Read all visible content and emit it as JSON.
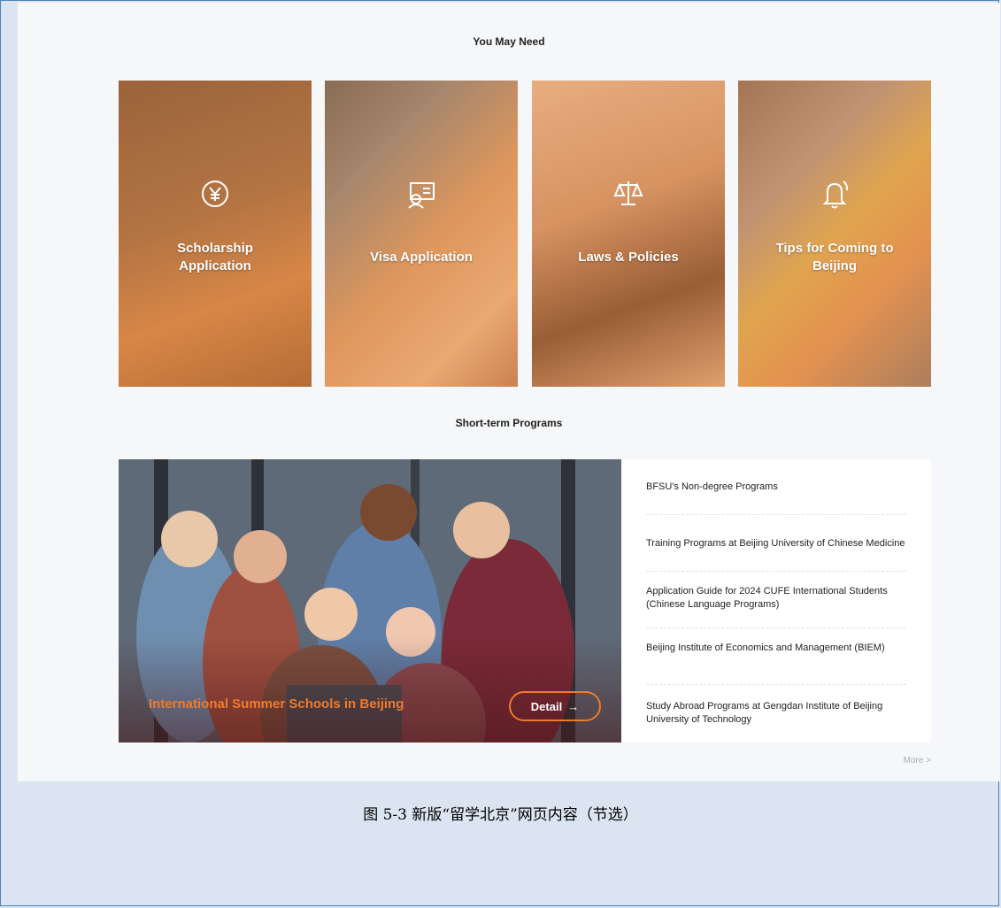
{
  "sections": {
    "you_may_need": "You May Need",
    "short_term": "Short-term Programs"
  },
  "cards": [
    {
      "label": "Scholarship\nApplication",
      "icon": "yuan-coin-icon"
    },
    {
      "label": "Visa Application",
      "icon": "id-card-icon"
    },
    {
      "label": "Laws & Policies",
      "icon": "scales-icon"
    },
    {
      "label": "Tips for Coming to\nBeijing",
      "icon": "bell-icon"
    }
  ],
  "promo": {
    "title": "International Summer Schools in Beijing",
    "detail_label": "Detail",
    "detail_arrow": "→"
  },
  "programs": [
    "BFSU's Non-degree Programs",
    "Training Programs at Beijing University of Chinese Medicine",
    "Application Guide for 2024 CUFE International Students (Chinese Language Programs)",
    "Beijing Institute of Economics and Management (BIEM)",
    "Study Abroad Programs at Gengdan Institute of Beijing University of Technology"
  ],
  "more": "More >",
  "caption": "图 5-3 新版“留学北京”网页内容（节选）",
  "colors": {
    "accent": "#f07a2c",
    "frame_border": "#4f81bd",
    "outer_bg": "#dbe5f1"
  }
}
